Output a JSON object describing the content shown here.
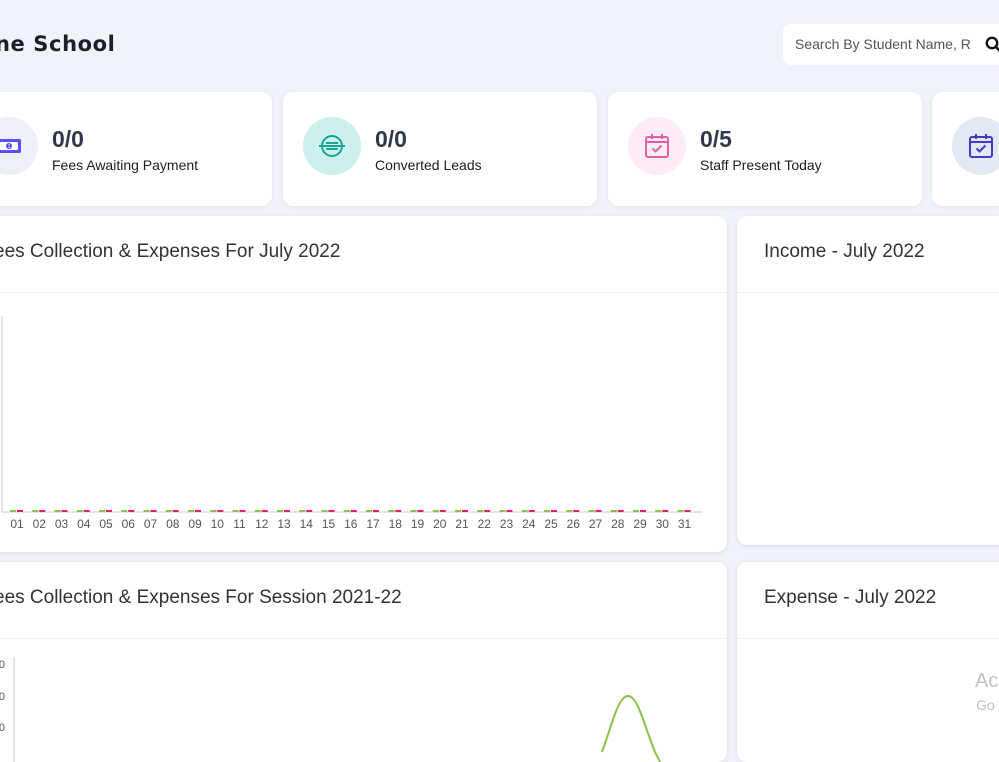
{
  "header": {
    "school_name": "ne School",
    "search": {
      "placeholder": "Search By Student Name, R"
    }
  },
  "stat_cards": [
    {
      "value": "0/0",
      "label": "Fees Awaiting Payment",
      "icon": "money-bill-icon",
      "color": "#5b4ff0",
      "bg": "#eef0f7"
    },
    {
      "value": "0/0",
      "label": "Converted Leads",
      "icon": "coin-icon",
      "color": "#16a693",
      "bg": "#cdf0ec"
    },
    {
      "value": "0/5",
      "label": "Staff Present Today",
      "icon": "calendar-check-icon",
      "color": "#e45da6",
      "bg": "#fdecf5"
    },
    {
      "value": "",
      "label": "",
      "icon": "calendar-check-icon",
      "color": "#4338ca",
      "bg": "#e3e8f5"
    }
  ],
  "panels": {
    "daily": {
      "title": "ees Collection & Expenses For July 2022"
    },
    "income": {
      "title": "Income - July 2022"
    },
    "session": {
      "title": "ees Collection & Expenses For Session 2021-22"
    },
    "expense": {
      "title": "Expense - July 2022"
    }
  },
  "watermark": {
    "line1": "Ac",
    "line2": "Go"
  },
  "chart_data": [
    {
      "type": "bar",
      "title": "ees Collection & Expenses For July 2022",
      "categories": [
        "01",
        "02",
        "03",
        "04",
        "05",
        "06",
        "07",
        "08",
        "09",
        "10",
        "11",
        "12",
        "13",
        "14",
        "15",
        "16",
        "17",
        "18",
        "19",
        "20",
        "21",
        "22",
        "23",
        "24",
        "25",
        "26",
        "27",
        "28",
        "29",
        "30",
        "31"
      ],
      "series": [
        {
          "values": [
            0,
            0,
            0,
            0,
            0,
            0,
            0,
            0,
            0,
            0,
            0,
            0,
            0,
            0,
            0,
            0,
            0,
            0,
            0,
            0,
            0,
            0,
            0,
            0,
            0,
            0,
            0,
            0,
            0,
            0,
            0
          ],
          "color": "#8bc34a"
        },
        {
          "values": [
            0,
            0,
            0,
            0,
            0,
            0,
            0,
            0,
            0,
            0,
            0,
            0,
            0,
            0,
            0,
            0,
            0,
            0,
            0,
            0,
            0,
            0,
            0,
            0,
            0,
            0,
            0,
            0,
            0,
            0,
            0
          ],
          "color": "#e91e63"
        }
      ]
    },
    {
      "type": "line",
      "title": "ees Collection & Expenses For Session 2021-22",
      "ytick_labels": [
        "0",
        "0",
        "0"
      ],
      "series": [
        {
          "color": "#8bc34a"
        }
      ]
    }
  ]
}
